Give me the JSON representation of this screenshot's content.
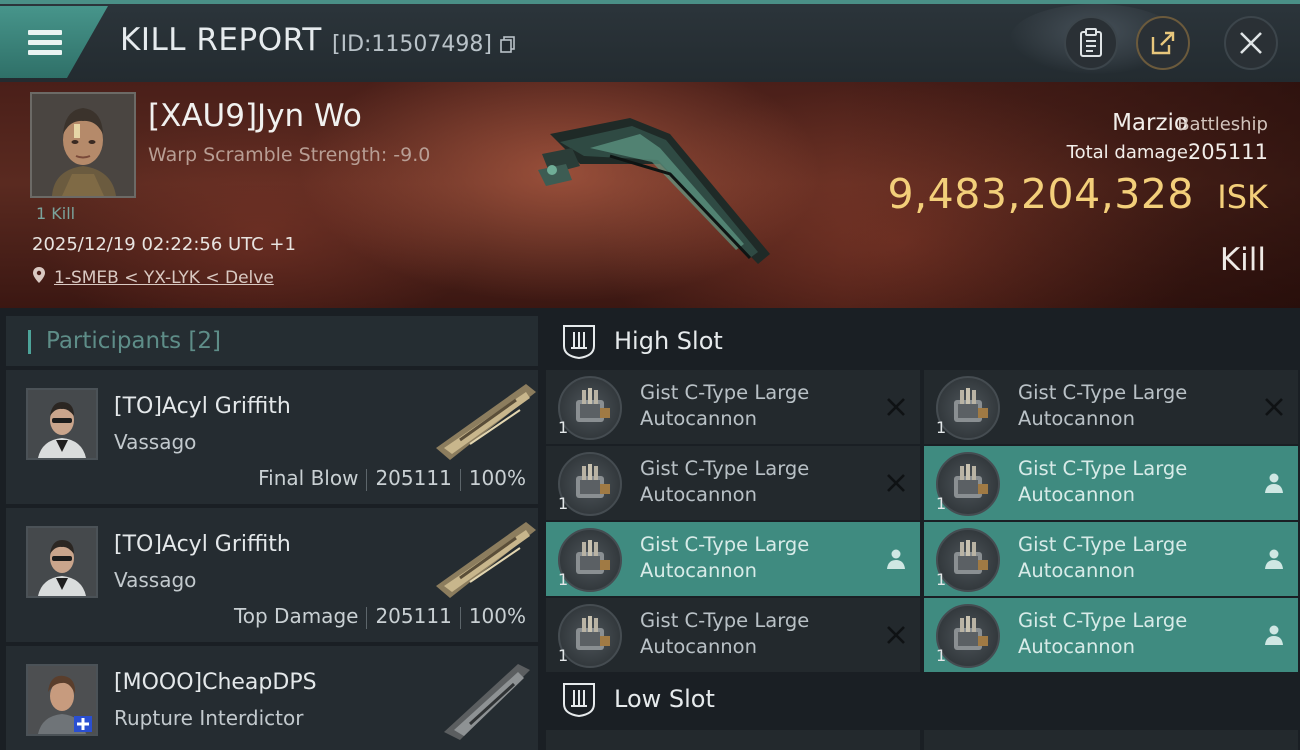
{
  "header": {
    "title": "KILL REPORT",
    "id_text": "[ID:11507498]"
  },
  "victim": {
    "name": "[XAU9]Jyn Wo",
    "warp_scramble": "Warp Scramble Strength: -9.0",
    "kill_count": "1 Kill",
    "timestamp": "2025/12/19 02:22:56 UTC +1",
    "location": "1-SMEB < YX-LYK < Delve",
    "ship_name": "Marzio",
    "ship_class": "Battleship",
    "total_damage_label": "Total damage:",
    "total_damage": "205111",
    "isk_value": "9,483,204,328",
    "isk_unit": "ISK",
    "kill_type": "Kill"
  },
  "participants": {
    "title": "Participants",
    "count": "[2]",
    "rows": [
      {
        "name": "[TO]Acyl Griffith",
        "ship": "Vassago",
        "role": "Final Blow",
        "damage": "205111",
        "percent": "100%"
      },
      {
        "name": "[TO]Acyl Griffith",
        "ship": "Vassago",
        "role": "Top Damage",
        "damage": "205111",
        "percent": "100%"
      },
      {
        "name": "[MOOO]CheapDPS",
        "ship": "Rupture Interdictor"
      }
    ]
  },
  "slots": {
    "high_label": "High Slot",
    "low_label": "Low Slot",
    "high_modules": [
      {
        "line1": "Gist C-Type Large",
        "line2": "Autocannon",
        "qty": "1",
        "status": "destroyed"
      },
      {
        "line1": "Gist C-Type Large",
        "line2": "Autocannon",
        "qty": "1",
        "status": "destroyed"
      },
      {
        "line1": "Gist C-Type Large",
        "line2": "Autocannon",
        "qty": "1",
        "status": "destroyed"
      },
      {
        "line1": "Gist C-Type Large",
        "line2": "Autocannon",
        "qty": "1",
        "status": "dropped"
      },
      {
        "line1": "Gist C-Type Large",
        "line2": "Autocannon",
        "qty": "1",
        "status": "dropped"
      },
      {
        "line1": "Gist C-Type Large",
        "line2": "Autocannon",
        "qty": "1",
        "status": "dropped"
      },
      {
        "line1": "Gist C-Type Large",
        "line2": "Autocannon",
        "qty": "1",
        "status": "destroyed"
      },
      {
        "line1": "Gist C-Type Large",
        "line2": "Autocannon",
        "qty": "1",
        "status": "dropped"
      }
    ]
  },
  "colors": {
    "accent": "#4da49a",
    "isk": "#f3cf7a",
    "dropped_bg": "#3f8b80"
  },
  "icons": [
    "menu-icon",
    "copy-icon",
    "clipboard-icon",
    "share-icon",
    "close-icon",
    "location-pin-icon",
    "slot-icon",
    "destroyed-x-icon",
    "dropped-person-icon"
  ]
}
